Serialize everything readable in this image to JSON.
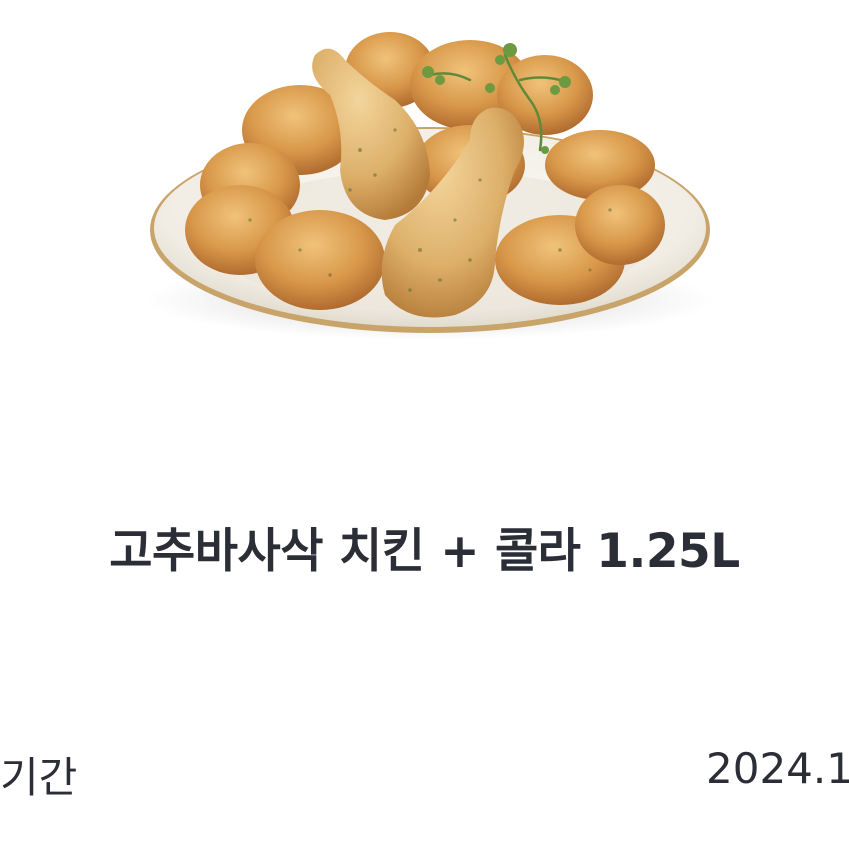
{
  "product": {
    "title": "고추바사삭 치킨 + 콜라 1.25L",
    "image_icon": "fried-chicken-plate-image"
  },
  "info": {
    "label": "기간",
    "value": "2024.1"
  },
  "colors": {
    "text": "#2b2e36",
    "background": "#ffffff",
    "plate_rim": "#c9a46a",
    "chicken": "#d79a4a"
  }
}
